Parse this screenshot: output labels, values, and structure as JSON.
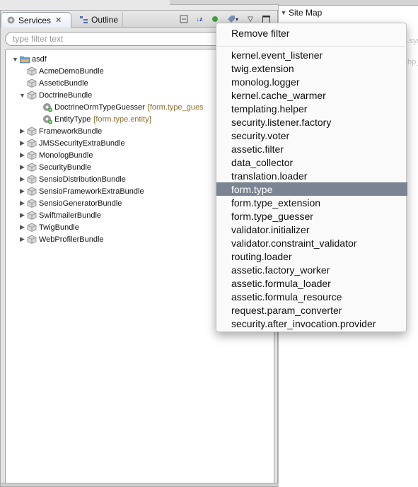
{
  "right_panel": {
    "site_map_label": "Site Map",
    "faint_texts": [
      "s.sym",
      "hp_"
    ]
  },
  "view": {
    "tabs": [
      {
        "label": "Services",
        "icon": "gear-icon",
        "active": true
      },
      {
        "label": "Outline",
        "icon": "outline-icon",
        "active": false
      }
    ],
    "toolbar_icons": [
      "collapse-all-icon",
      "sort-az-icon",
      "green-dot-icon",
      "tag-filter-icon",
      "view-menu-icon",
      "maximize-icon"
    ]
  },
  "filter": {
    "placeholder": "type filter text",
    "value": ""
  },
  "tree": {
    "root": "asdf",
    "items": [
      {
        "label": "AcmeDemoBundle",
        "level": 1,
        "expander": ""
      },
      {
        "label": "AsseticBundle",
        "level": 1,
        "expander": ""
      },
      {
        "label": "DoctrineBundle",
        "level": 1,
        "expander": "open"
      },
      {
        "label": "DoctrineOrmTypeGuesser",
        "tag": "[form.type_gues",
        "level": 2,
        "expander": ""
      },
      {
        "label": "EntityType",
        "tag": "[form.type.entity]",
        "level": 2,
        "expander": ""
      },
      {
        "label": "FrameworkBundle",
        "level": 1,
        "expander": "closed"
      },
      {
        "label": "JMSSecurityExtraBundle",
        "level": 1,
        "expander": "closed"
      },
      {
        "label": "MonologBundle",
        "level": 1,
        "expander": "closed"
      },
      {
        "label": "SecurityBundle",
        "level": 1,
        "expander": "closed"
      },
      {
        "label": "SensioDistributionBundle",
        "level": 1,
        "expander": "closed"
      },
      {
        "label": "SensioFrameworkExtraBundle",
        "level": 1,
        "expander": "closed"
      },
      {
        "label": "SensioGeneratorBundle",
        "level": 1,
        "expander": "closed"
      },
      {
        "label": "SwiftmailerBundle",
        "level": 1,
        "expander": "closed"
      },
      {
        "label": "TwigBundle",
        "level": 1,
        "expander": "closed"
      },
      {
        "label": "WebProfilerBundle",
        "level": 1,
        "expander": "closed"
      }
    ]
  },
  "menu": {
    "remove_filter": "Remove filter",
    "items": [
      "kernel.event_listener",
      "twig.extension",
      "monolog.logger",
      "kernel.cache_warmer",
      "templating.helper",
      "security.listener.factory",
      "security.voter",
      "assetic.filter",
      "data_collector",
      "translation.loader",
      "form.type",
      "form.type_extension",
      "form.type_guesser",
      "validator.initializer",
      "validator.constraint_validator",
      "routing.loader",
      "assetic.factory_worker",
      "assetic.formula_loader",
      "assetic.formula_resource",
      "request.param_converter",
      "security.after_invocation.provider"
    ],
    "selected": "form.type",
    "selected_color": "#7b8492"
  }
}
